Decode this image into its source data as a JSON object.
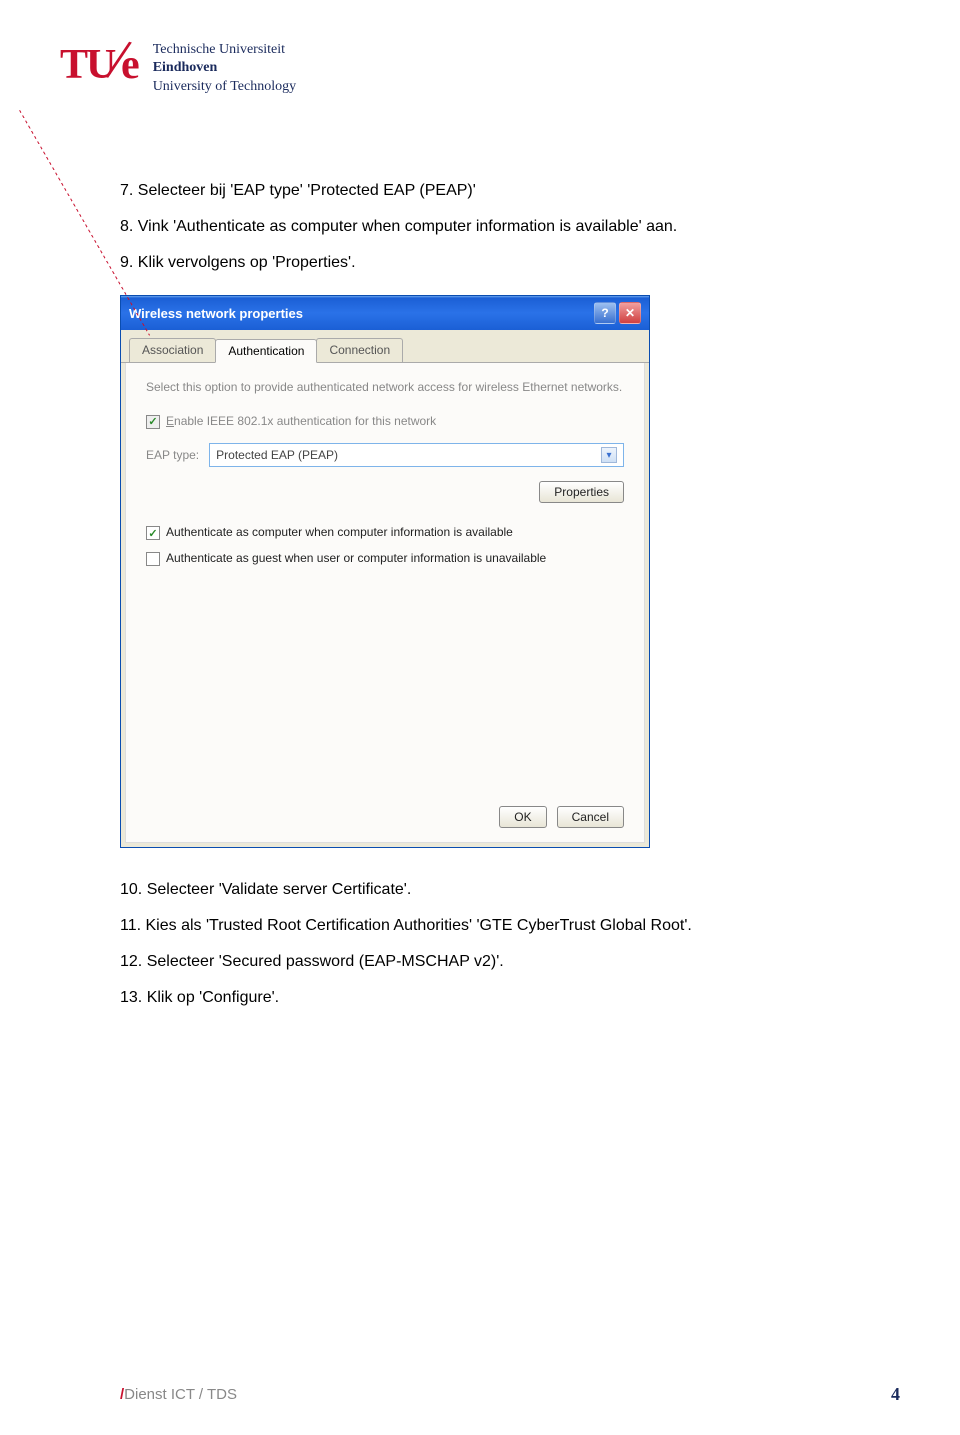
{
  "logo": {
    "tu": "TU",
    "e": "e",
    "line1": "Technische Universiteit",
    "line2_bold": "Eindhoven",
    "line3": "University of Technology"
  },
  "steps": {
    "s7": "7.  Selecteer bij 'EAP type' 'Protected EAP (PEAP)'",
    "s8": "8.  Vink 'Authenticate as computer when computer information is available' aan.",
    "s9": "9.  Klik vervolgens op 'Properties'.",
    "s10": "10. Selecteer 'Validate server Certificate'.",
    "s11": "11. Kies als 'Trusted Root Certification Authorities' 'GTE CyberTrust Global Root'.",
    "s12": "12. Selecteer 'Secured password (EAP-MSCHAP v2)'.",
    "s13": "13. Klik op 'Configure'."
  },
  "dialog": {
    "title": "Wireless network properties",
    "tabs": {
      "assoc": "Association",
      "auth": "Authentication",
      "conn": "Connection"
    },
    "instr": "Select this option to provide authenticated network access for wireless Ethernet networks.",
    "enable": "Enable IEEE 802.1x authentication for this network",
    "eap_label": "EAP type:",
    "eap_value": "Protected EAP (PEAP)",
    "properties": "Properties",
    "auth_computer": "Authenticate as computer when computer information is available",
    "auth_guest": "Authenticate as guest when user or computer information is unavailable",
    "ok": "OK",
    "cancel": "Cancel"
  },
  "footer": {
    "text": "Dienst ICT / TDS",
    "page": "4"
  }
}
